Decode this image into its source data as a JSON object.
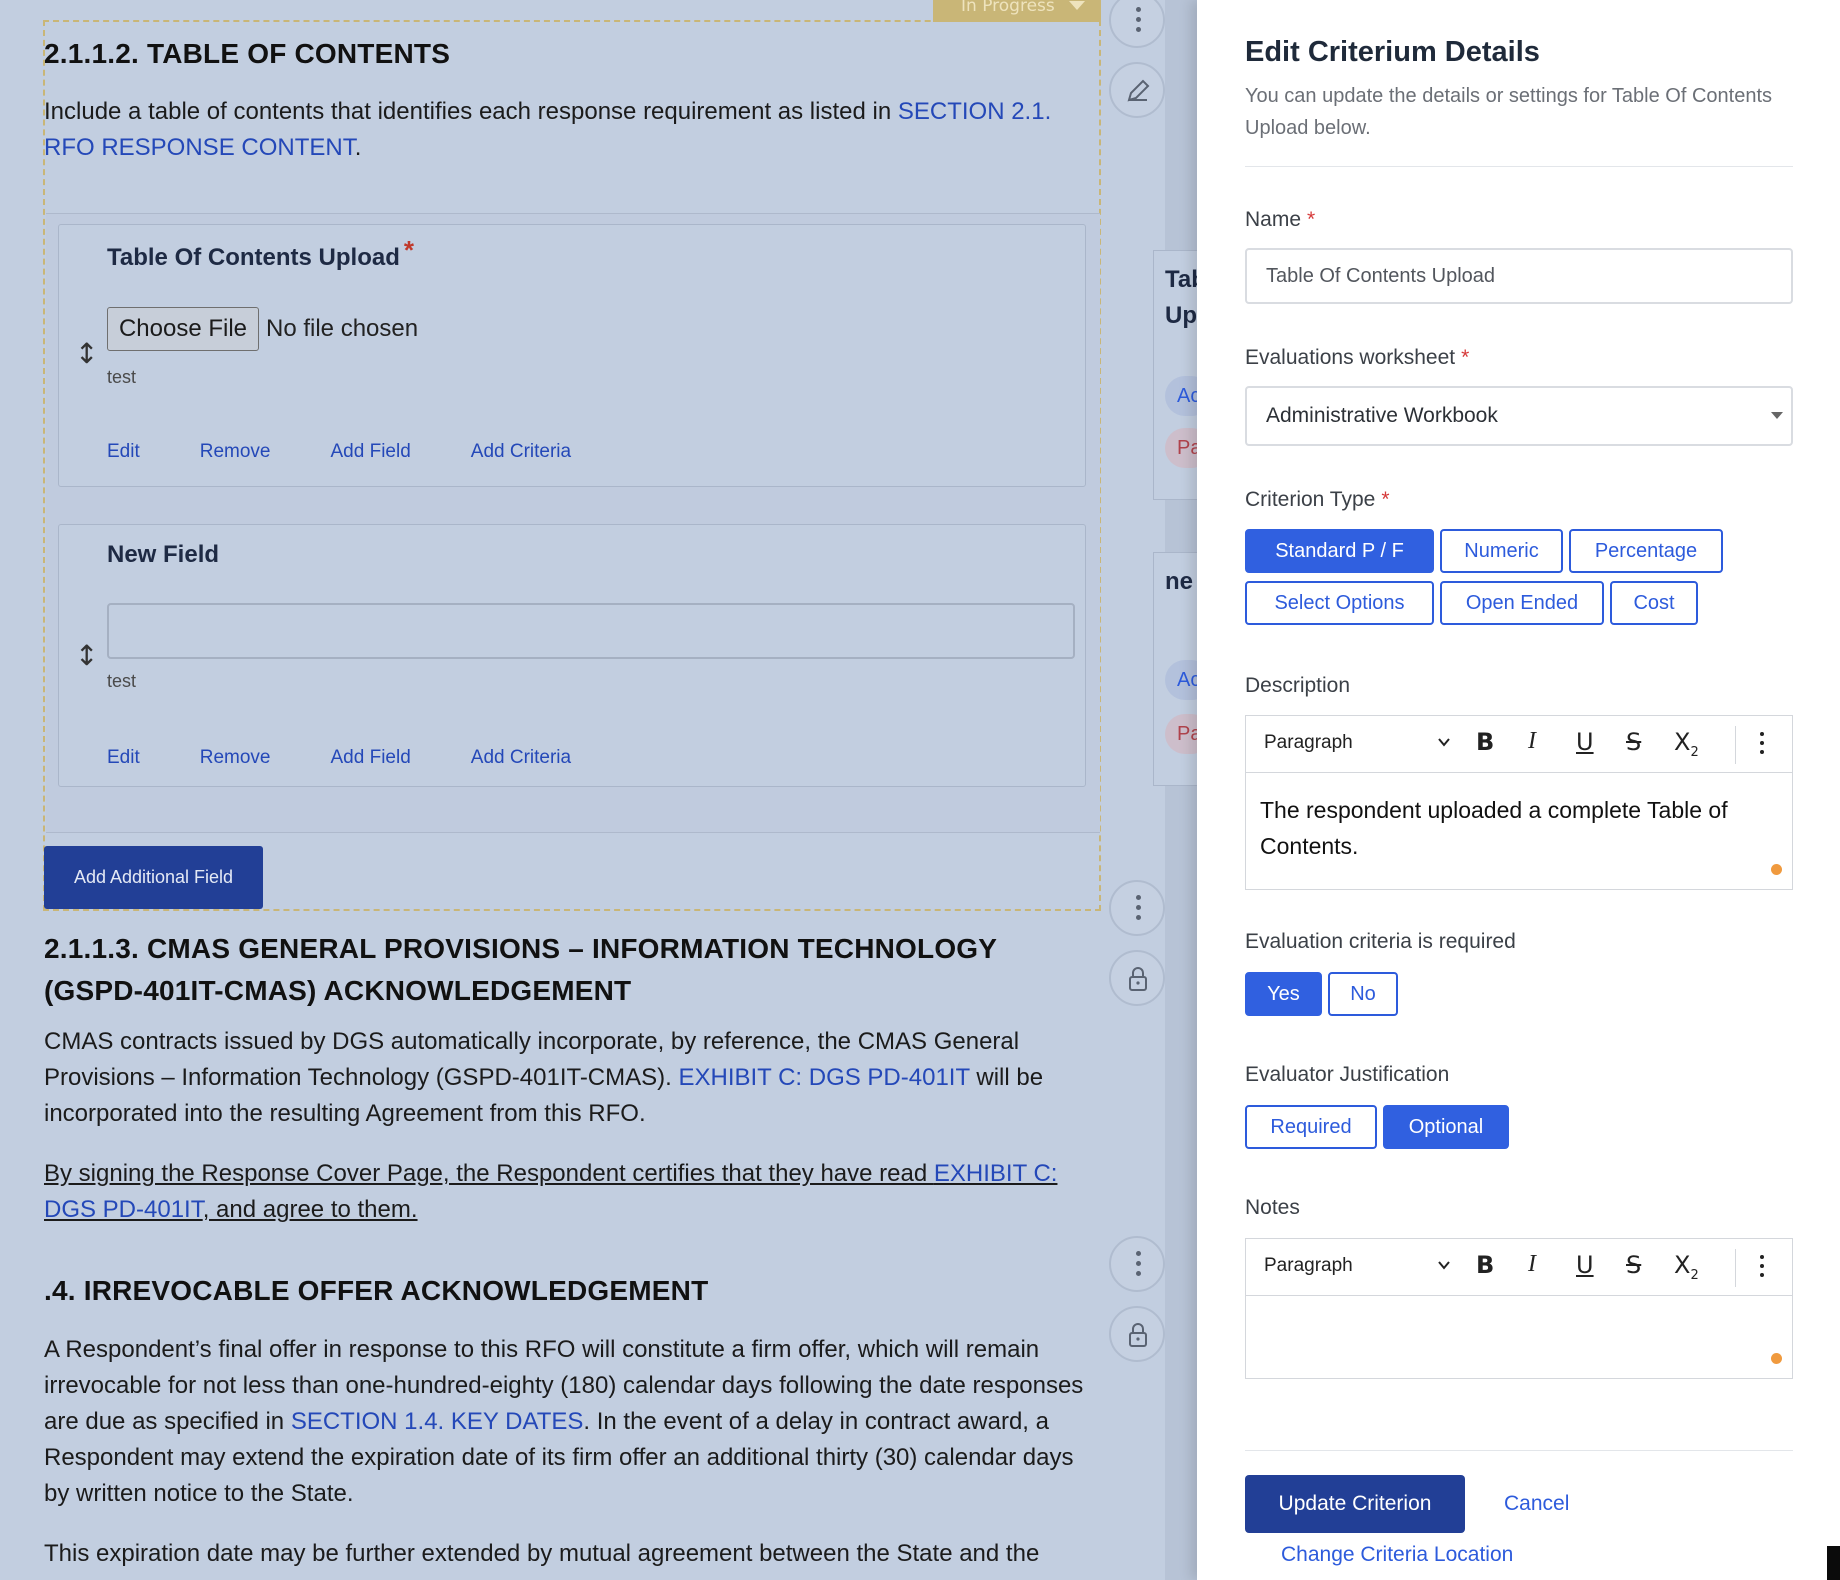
{
  "document": {
    "status_tab": "In Progress",
    "section_212": {
      "heading": "2.1.1.2. TABLE OF CONTENTS",
      "intro_text": "Include a table of contents that identifies each response requirement as listed in ",
      "intro_link": "SECTION 2.1. RFO RESPONSE CONTENT",
      "intro_end": "."
    },
    "fields": [
      {
        "title": "Table Of Contents Upload",
        "required_mark": "*",
        "choose_file": "Choose File",
        "no_file": "No file chosen",
        "help": "test",
        "actions": [
          "Edit",
          "Remove",
          "Add Field",
          "Add Criteria"
        ]
      },
      {
        "title": "New Field",
        "help": "test",
        "actions": [
          "Edit",
          "Remove",
          "Add Field",
          "Add Criteria"
        ]
      }
    ],
    "add_additional_field": "Add Additional Field",
    "section_213": {
      "heading_line1": "2.1.1.3. CMAS GENERAL PROVISIONS – INFORMATION TECHNOLOGY",
      "heading_line2": "(GSPD-401IT-CMAS) ACKNOWLEDGEMENT",
      "p1_a": "CMAS contracts issued by DGS automatically incorporate, by reference, the CMAS General Provisions – Information Technology (GSPD-401IT-CMAS). ",
      "p1_link": "EXHIBIT C: DGS PD-401IT",
      "p1_b": " will be incorporated into the resulting Agreement from this RFO.",
      "p2_a": "By signing the Response Cover Page, the Respondent certifies that they have read ",
      "p2_link": "EXHIBIT C: DGS PD-401IT",
      "p2_b": ", and agree to them."
    },
    "section_214": {
      "heading": ".4. IRREVOCABLE OFFER ACKNOWLEDGEMENT",
      "p1_a": "A Respondent’s final offer in response to this RFO will constitute a firm offer, which will remain irrevocable for not less than one-hundred-eighty (180) calendar days following the date responses are due as specified in ",
      "p1_link": "SECTION 1.4. KEY DATES",
      "p1_b": ".  In the event of a delay in contract award, a Respondent may extend the expiration date of its firm offer an additional thirty (30) calendar days by written notice to the State.",
      "p2": "This expiration date may be further extended by mutual agreement between the State and the"
    },
    "ghost": {
      "title_1a": "Tab",
      "title_1b": "Up",
      "pill_a": "Ac",
      "pill_b": "Pa",
      "title_2": "ne"
    }
  },
  "panel": {
    "title": "Edit Criterium Details",
    "subtitle": "You can update the details or settings for Table Of Contents Upload below.",
    "name_label": "Name",
    "name_value": "Table Of Contents Upload",
    "worksheet_label": "Evaluations worksheet",
    "worksheet_value": "Administrative Workbook",
    "type_label": "Criterion Type",
    "types": [
      "Standard P / F",
      "Numeric",
      "Percentage",
      "Select Options",
      "Open Ended",
      "Cost"
    ],
    "type_selected": "Standard P / F",
    "description_label": "Description",
    "paragraph_label": "Paragraph",
    "description_text": "The respondent uploaded a complete Table of Contents.",
    "required_label": "Evaluation criteria is required",
    "yes": "Yes",
    "no": "No",
    "justification_label": "Evaluator Justification",
    "required_opt": "Required",
    "optional_opt": "Optional",
    "notes_label": "Notes",
    "update_button": "Update Criterion",
    "cancel": "Cancel",
    "change_location": "Change Criteria Location",
    "required_star": "*"
  },
  "colors": {
    "primary": "#3060e0",
    "dark_primary": "#223f96",
    "link": "#2448b8",
    "status": "#c9b677"
  }
}
